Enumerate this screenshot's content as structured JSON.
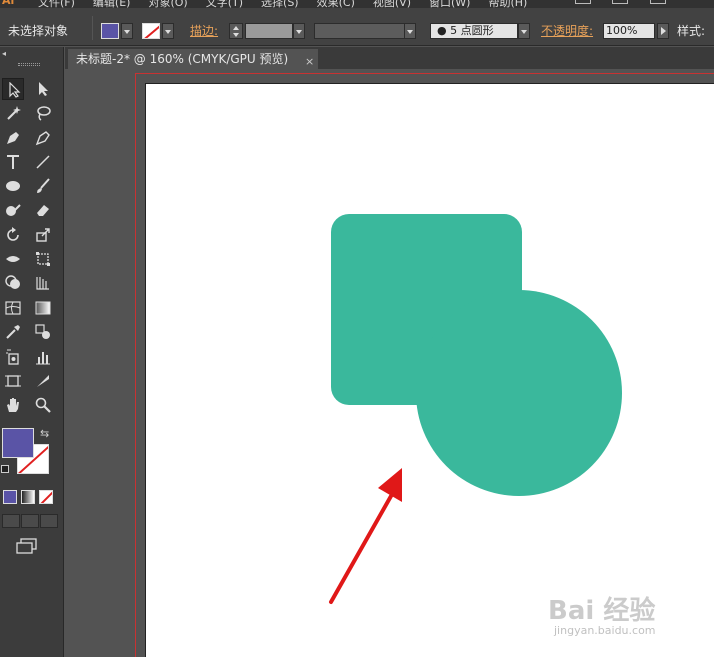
{
  "menubar": {
    "logo": "Ai",
    "items": [
      "文件(F)",
      "编辑(E)",
      "对象(O)",
      "文字(T)",
      "选择(S)",
      "效果(C)",
      "视图(V)",
      "窗口(W)",
      "帮助(H)"
    ]
  },
  "controlbar": {
    "selection_status": "未选择对象",
    "stroke_label": "描边:",
    "brush_label": "5 点圆形",
    "opacity_label": "不透明度:",
    "opacity_value": "100%",
    "style_label": "样式:",
    "fill_color": "#5a54a6"
  },
  "document": {
    "tab_title": "未标题-2* @ 160% (CMYK/GPU 预览)",
    "tab_close": "×"
  },
  "canvas": {
    "shape_color": "#3ab89c",
    "arrow_color": "#e01818"
  },
  "tools": {
    "fill_color": "#5a54a6",
    "items": [
      "selection-tool",
      "direct-selection-tool",
      "magic-wand-tool",
      "lasso-tool",
      "pen-tool",
      "curvature-tool",
      "type-tool",
      "line-segment-tool",
      "ellipse-tool",
      "paintbrush-tool",
      "shaper-tool",
      "eraser-tool",
      "rotate-tool",
      "scale-tool",
      "width-tool",
      "free-transform-tool",
      "shape-builder-tool",
      "perspective-grid-tool",
      "mesh-tool",
      "gradient-tool",
      "eyedropper-tool",
      "blend-tool",
      "symbol-sprayer-tool",
      "column-graph-tool",
      "artboard-tool",
      "slice-tool",
      "hand-tool",
      "zoom-tool"
    ]
  },
  "watermark": {
    "brand": "Bai 经验",
    "url": "jingyan.baidu.com"
  }
}
